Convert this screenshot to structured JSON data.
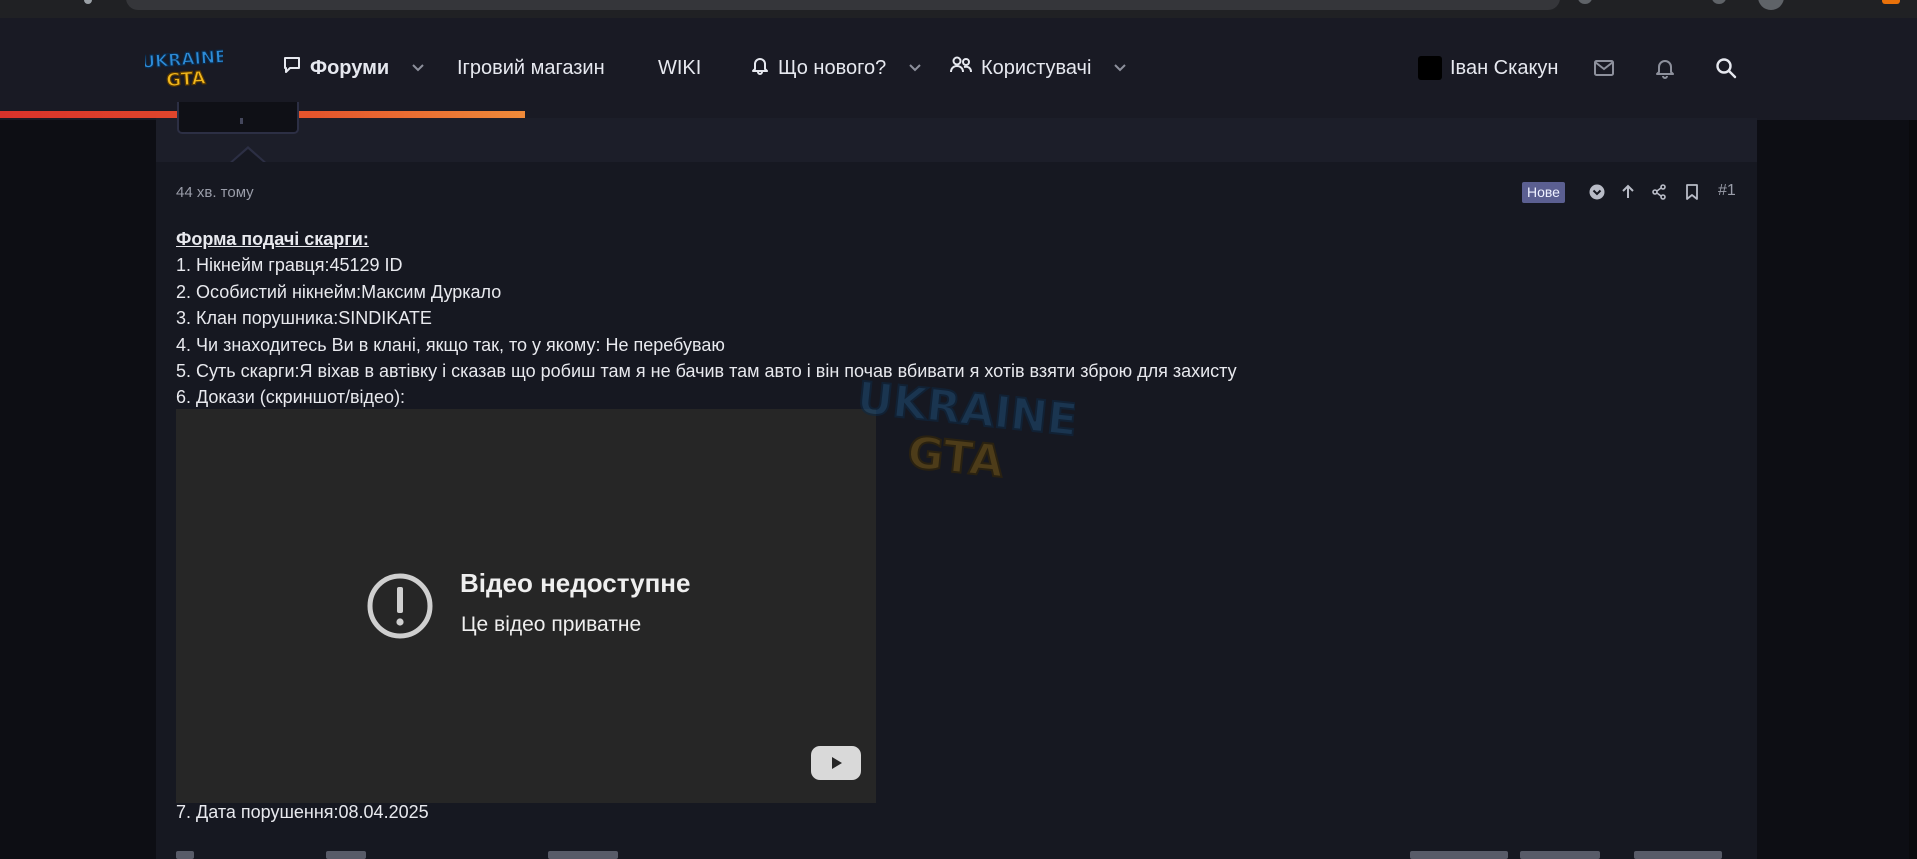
{
  "header": {
    "logo_alt": "UKRAINE GTA",
    "nav": {
      "forums": "Форуми",
      "shop": "Ігровий магазин",
      "wiki": "WIKI",
      "whats_new": "Що нового?",
      "users": "Користувачі"
    },
    "user_name": "Іван Скакун"
  },
  "post": {
    "time": "44 хв. тому",
    "badge": "Нове",
    "number": "#1",
    "form_title": "Форма подачі скарги:",
    "lines": [
      "1. Нікнейм гравця:45129 ID",
      "2. Особистий нікнейм:Максим Дуркало",
      "3. Клан порушника:SINDIKATE",
      "4. Чи знаходитесь Ви в клані, якщо так, то у якому: Не перебуваю",
      "5. Суть скарги:Я віхав в автівку і сказав що робиш там я не бачив там авто і він почав вбивати я хотів взяти зброю для захисту",
      "6. Докази (скриншот/відео):"
    ],
    "video": {
      "title": "Відео недоступне",
      "subtitle": "Це відео приватне"
    },
    "date_line": "7. Дата порушення:08.04.2025"
  },
  "colors": {
    "background": "#101118",
    "header": "#191a24",
    "post": "#161821",
    "badge": "#5b5f91",
    "progress_start": "#d9322b",
    "progress_end": "#ef8a39"
  }
}
